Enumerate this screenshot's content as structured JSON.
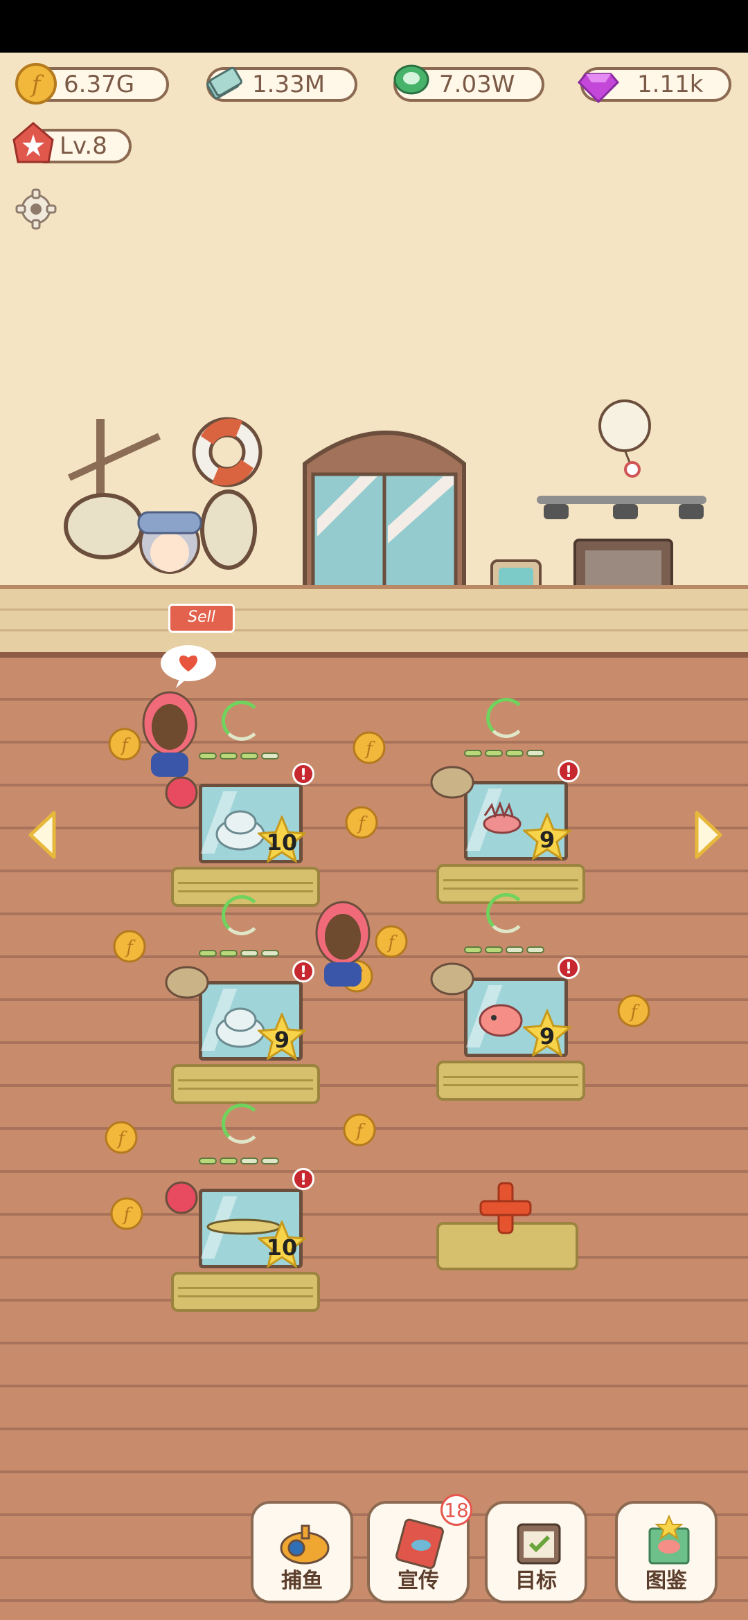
{
  "resources": {
    "coins": "6.37G",
    "cash": "1.33M",
    "tickets": "7.03W",
    "gems": "1.11k"
  },
  "player": {
    "level": "Lv.8"
  },
  "shop": {
    "sign": "Sell"
  },
  "tanks": [
    {
      "level": "10",
      "fish": "shell"
    },
    {
      "level": "9",
      "fish": "lionfish"
    },
    {
      "level": "9",
      "fish": "shell"
    },
    {
      "level": "9",
      "fish": "pufferfish"
    },
    {
      "level": "10",
      "fish": "gar-fish"
    }
  ],
  "nav": {
    "fishing": "捕鱼",
    "promote": "宣传",
    "promote_badge": "18",
    "goals": "目标",
    "catalog": "图鉴"
  },
  "colors": {
    "coin": "#f2b83c",
    "gem": "#c347d9",
    "accent": "#e7574d"
  }
}
